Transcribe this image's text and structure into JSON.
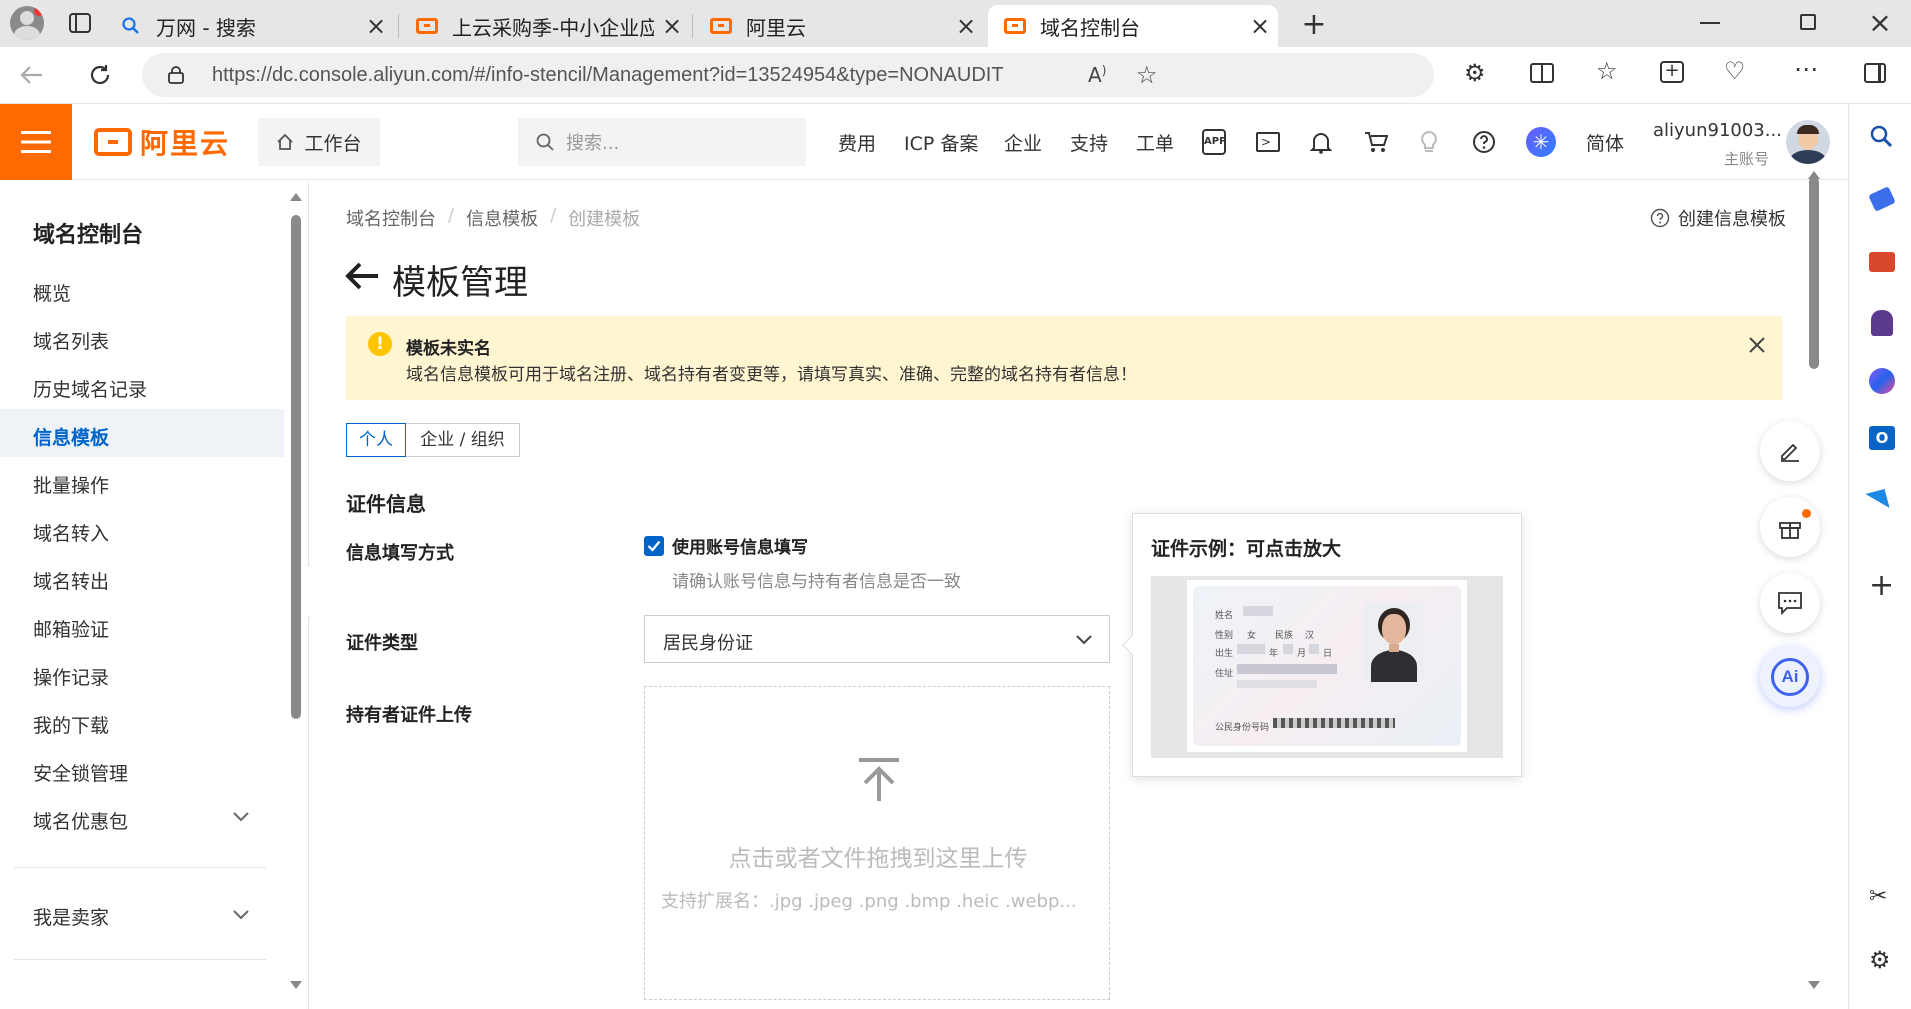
{
  "browser": {
    "tabs": [
      {
        "title": "万网 - 搜索"
      },
      {
        "title": "上云采购季-中小企业应用会场-阿"
      },
      {
        "title": "阿里云"
      },
      {
        "title": "域名控制台"
      }
    ],
    "url": "https://dc.console.aliyun.com/#/info-stencil/Management?id=13524954&type=NONAUDIT"
  },
  "header": {
    "logo_text": "阿里云",
    "workbench": "工作台",
    "search_placeholder": "搜索...",
    "nav": [
      "费用",
      "ICP 备案",
      "企业",
      "支持",
      "工单"
    ],
    "lang": "简体",
    "user_name": "aliyun91003...",
    "user_role": "主账号"
  },
  "sidebar": {
    "title": "域名控制台",
    "items": [
      {
        "label": "概览"
      },
      {
        "label": "域名列表"
      },
      {
        "label": "历史域名记录"
      },
      {
        "label": "信息模板"
      },
      {
        "label": "批量操作"
      },
      {
        "label": "域名转入"
      },
      {
        "label": "域名转出"
      },
      {
        "label": "邮箱验证"
      },
      {
        "label": "操作记录"
      },
      {
        "label": "我的下载"
      },
      {
        "label": "安全锁管理"
      },
      {
        "label": "域名优惠包"
      }
    ],
    "seller": "我是卖家",
    "active_index": 3
  },
  "main": {
    "breadcrumb": [
      "域名控制台",
      "信息模板",
      "创建模板"
    ],
    "help_link": "创建信息模板",
    "page_title": "模板管理",
    "alert": {
      "title": "模板未实名",
      "text": "域名信息模板可用于域名注册、域名持有者变更等，请填写真实、准确、完整的域名持有者信息！"
    },
    "tabs": [
      "个人",
      "企业 / 组织"
    ],
    "section_title": "证件信息",
    "fill_method_label": "信息填写方式",
    "fill_checkbox_label": "使用账号信息填写",
    "fill_hint": "请确认账号信息与持有者信息是否一致",
    "cert_type_label": "证件类型",
    "cert_type_value": "居民身份证",
    "upload_label": "持有者证件上传",
    "upload_text": "点击或者文件拖拽到这里上传",
    "upload_ext": "支持扩展名：.jpg .jpeg .png .bmp .heic .webp...",
    "example_title": "证件示例：可点击放大"
  },
  "id_card": {
    "name": "姓名",
    "sex_label": "性别",
    "sex": "女",
    "ethnic_label": "民族",
    "ethnic": "汉",
    "birth_label": "出生",
    "y": "年",
    "m": "月",
    "d": "日",
    "addr": "住址",
    "idno": "公民身份号码"
  },
  "colors": {
    "brand": "#ff6a00",
    "primary": "#0064c8",
    "alert_bg": "#fff5d1",
    "active_nav_bg": "#eff3f8"
  }
}
